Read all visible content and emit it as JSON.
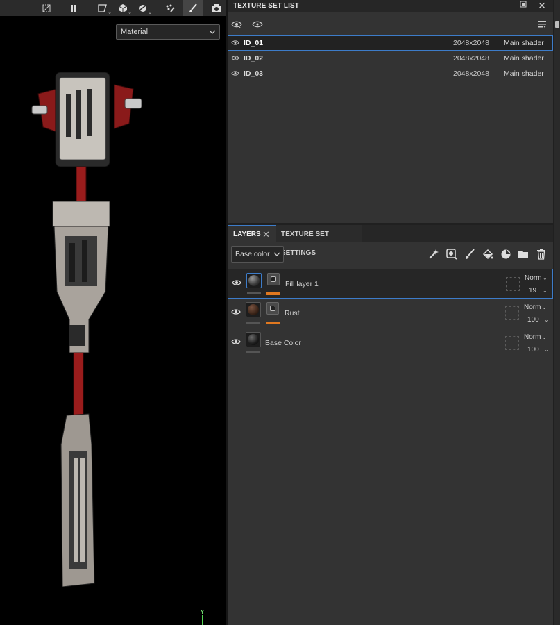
{
  "viewport": {
    "material_select": "Material",
    "toolbar_icons": [
      "hide-icon",
      "pause-icon",
      "selection-shape-icon",
      "cube-icon",
      "lighting-icon",
      "particle-brush-icon",
      "paint-brush-icon",
      "camera-icon"
    ],
    "axis_label": "Y"
  },
  "texture_set_list": {
    "title": "TEXTURE SET LIST",
    "rows": [
      {
        "name": "ID_01",
        "resolution": "2048x2048",
        "shader": "Main shader",
        "selected": true
      },
      {
        "name": "ID_02",
        "resolution": "2048x2048",
        "shader": "Main shader",
        "selected": false
      },
      {
        "name": "ID_03",
        "resolution": "2048x2048",
        "shader": "Main shader",
        "selected": false
      }
    ]
  },
  "tabs": {
    "layers": "LAYERS",
    "texture_set_settings": "TEXTURE SET SETTINGS"
  },
  "layers_panel": {
    "channel_select": "Base color",
    "layers": [
      {
        "name": "Fill layer 1",
        "blend": "Norm",
        "opacity": "19",
        "has_mask": true,
        "selected": true,
        "thumb_color": "#3a3a3a"
      },
      {
        "name": "Rust",
        "blend": "Norm",
        "opacity": "100",
        "has_mask": true,
        "selected": false,
        "thumb_color": "#4a2e20"
      },
      {
        "name": "Base Color",
        "blend": "Norm",
        "opacity": "100",
        "has_mask": false,
        "selected": false,
        "thumb_color": "#222222"
      }
    ]
  },
  "colors": {
    "accent": "#3d7cc9",
    "mask_bar": "#e07820",
    "panel_bg": "#333333"
  }
}
